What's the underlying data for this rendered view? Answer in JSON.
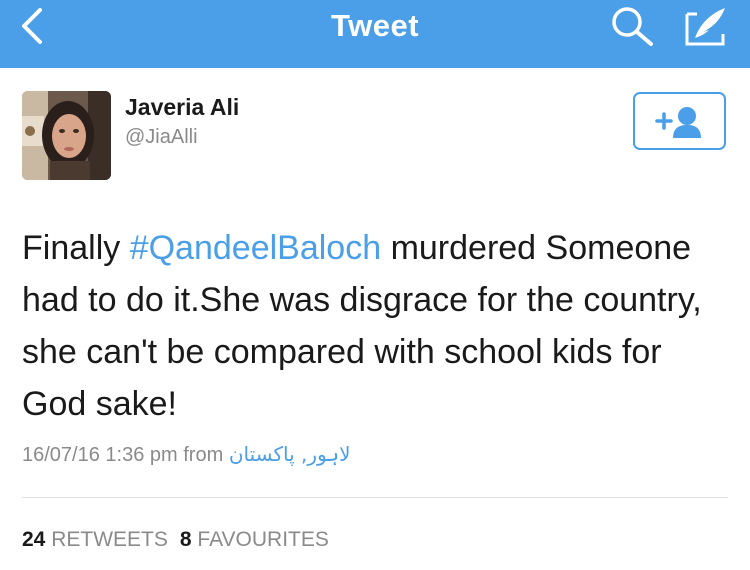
{
  "nav": {
    "title": "Tweet",
    "color": "#4a9fe8",
    "back_icon": "chevron-left-icon",
    "search_icon": "search-icon",
    "compose_icon": "compose-tweet-icon"
  },
  "user": {
    "name": "Javeria Ali",
    "handle": "@JiaAlli",
    "follow_icon": "add-user-icon"
  },
  "tweet": {
    "text_before": "Finally ",
    "hashtag": "#QandeelBaloch",
    "text_after": " murdered Someone had to do it.She was disgrace for the country, she can't be compared with school kids for God sake!",
    "timestamp": "16/07/16 1:36 pm",
    "from_label": "from",
    "location": "لاہور, پاکستان"
  },
  "stats": {
    "retweets_count": "24",
    "retweets_label": "RETWEETS",
    "favourites_count": "8",
    "favourites_label": "FAVOURITES"
  }
}
